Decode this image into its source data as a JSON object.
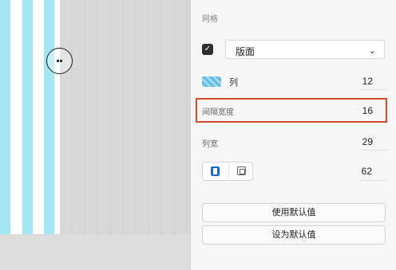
{
  "panel": {
    "section_title": "网格",
    "grid_type": {
      "checked": true,
      "selected": "版面"
    },
    "columns": {
      "label": "列",
      "value": "12"
    },
    "gutter_width": {
      "label": "间隔宽度",
      "value": "16"
    },
    "column_width": {
      "label": "列宽",
      "value": "29"
    },
    "margin": {
      "value": "62"
    },
    "buttons": {
      "use_default": "使用默认值",
      "set_default": "设为默认值"
    }
  },
  "colors": {
    "grid_column": "#a5e6f3",
    "highlight": "#d24a2a",
    "accent": "#1e66d0"
  },
  "icons": [
    "checkbox-check-icon",
    "chevron-down-icon",
    "grid-columns-icon",
    "column-align-icon",
    "frame-align-icon",
    "cursor-icon"
  ]
}
